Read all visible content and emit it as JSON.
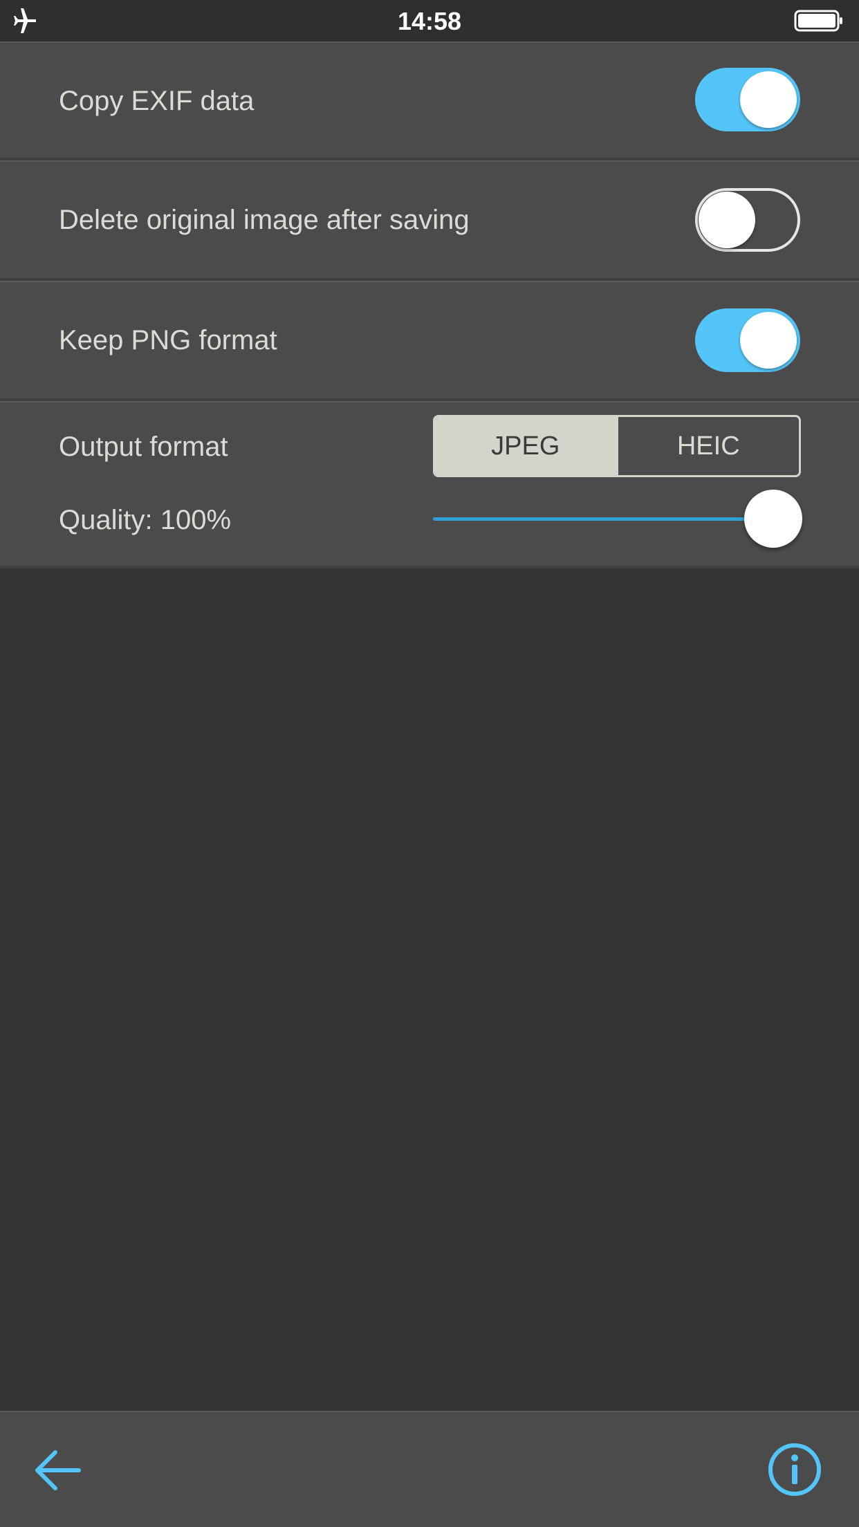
{
  "status_bar": {
    "time": "14:58",
    "airplane_icon": "airplane-icon",
    "battery_icon": "battery-full-icon"
  },
  "settings": {
    "copy_exif": {
      "label": "Copy EXIF data",
      "enabled": true
    },
    "delete_original": {
      "label": "Delete original image after saving",
      "enabled": false
    },
    "keep_png": {
      "label": "Keep PNG format",
      "enabled": true
    },
    "output_format": {
      "label": "Output format",
      "options": [
        "JPEG",
        "HEIC"
      ],
      "selected": "JPEG"
    },
    "quality": {
      "label": "Quality: 100%",
      "value_percent": 100
    }
  },
  "toolbar": {
    "back_icon": "arrow-left-icon",
    "info_icon": "info-icon"
  },
  "colors": {
    "accent": "#54c5f8",
    "slider_fill": "#2f9fd8",
    "background": "#333333",
    "row_background": "#4b4b4b",
    "text": "#dcdcd6",
    "segment_selected": "#d4d3cc"
  }
}
